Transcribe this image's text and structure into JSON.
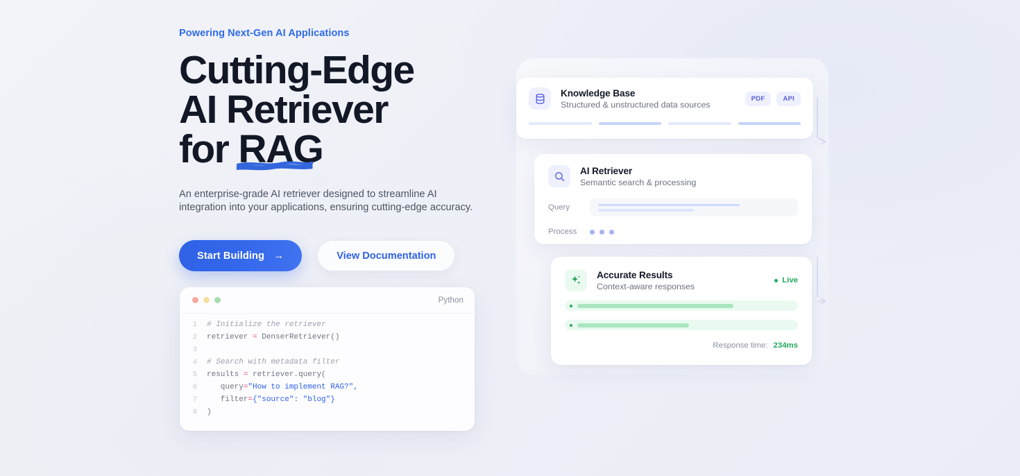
{
  "hero": {
    "eyebrow": "Powering Next-Gen AI Applications",
    "headline_line1": "Cutting-Edge",
    "headline_line2": "AI Retriever",
    "headline_line3_prefix": "for ",
    "headline_line3_highlight": "RAG",
    "subtitle": "An enterprise-grade AI retriever designed to streamline AI integration into your applications, ensuring cutting-edge accuracy.",
    "primary_cta": "Start Building",
    "primary_cta_arrow": "→",
    "secondary_cta": "View Documentation",
    "accent_blue": "#2f62e6",
    "eyebrow_color": "#2f6bea"
  },
  "code_card": {
    "language": "Python",
    "window_dots": [
      "red",
      "yellow",
      "green"
    ],
    "lines": [
      {
        "no": "1",
        "segments": [
          {
            "t": "# Initialize the retriever",
            "c": "cmt"
          }
        ]
      },
      {
        "no": "2",
        "segments": [
          {
            "t": "retriever ",
            "c": "pl"
          },
          {
            "t": "=",
            "c": "op"
          },
          {
            "t": " DenserRetriever()",
            "c": "pl"
          }
        ]
      },
      {
        "no": "3",
        "segments": [
          {
            "t": "",
            "c": "pl"
          }
        ]
      },
      {
        "no": "4",
        "segments": [
          {
            "t": "# Search with metadata filter",
            "c": "cmt"
          }
        ]
      },
      {
        "no": "5",
        "segments": [
          {
            "t": "results ",
            "c": "pl"
          },
          {
            "t": "=",
            "c": "op"
          },
          {
            "t": " retriever.query(",
            "c": "pl"
          }
        ]
      },
      {
        "no": "6",
        "segments": [
          {
            "t": "   query",
            "c": "pl"
          },
          {
            "t": "=",
            "c": "op"
          },
          {
            "t": "\"How to implement RAG?\",",
            "c": "str"
          }
        ]
      },
      {
        "no": "7",
        "segments": [
          {
            "t": "   filter",
            "c": "pl"
          },
          {
            "t": "=",
            "c": "op"
          },
          {
            "t": "{\"source\": \"blog\"}",
            "c": "str"
          }
        ]
      },
      {
        "no": "8",
        "segments": [
          {
            "t": ")",
            "c": "pl"
          }
        ]
      }
    ]
  },
  "cards": {
    "knowledge_base": {
      "icon": "database-icon",
      "title": "Knowledge Base",
      "subtitle": "Structured & unstructured data sources",
      "chips": [
        "PDF",
        "API"
      ],
      "bars": [
        "lite",
        "dark",
        "lite",
        "dark"
      ]
    },
    "ai_retriever": {
      "icon": "search-icon",
      "title": "AI Retriever",
      "subtitle": "Semantic search & processing",
      "query_label": "Query",
      "process_label": "Process",
      "process_dots": 3
    },
    "accurate_results": {
      "icon": "sparkles-icon",
      "title": "Accurate Results",
      "subtitle": "Context-aware responses",
      "status_label": "Live",
      "status_color": "#22a95e",
      "response_label": "Response time:",
      "response_value": "234ms"
    }
  }
}
